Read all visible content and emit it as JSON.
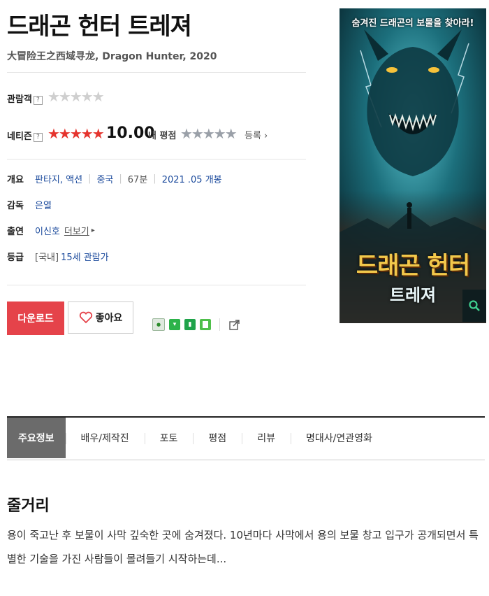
{
  "movie": {
    "title": "드래곤 헌터 트레져",
    "subtitle": "大冒险王之西域寻龙, Dragon Hunter, 2020"
  },
  "ratings": {
    "audience_label": "관람객",
    "audience_stars": 0,
    "netizen_label": "네티즌",
    "netizen_stars": 5,
    "netizen_score": "10.00",
    "my_rating_label": "내 평점",
    "my_stars": 0,
    "register_label": "등록"
  },
  "info": {
    "overview_label": "개요",
    "genre": "판타지, 액션",
    "country": "중국",
    "runtime": "67분",
    "release": "2021 .05 개봉",
    "director_label": "감독",
    "director": "은열",
    "cast_label": "출연",
    "cast": "이신호",
    "more_label": "더보기",
    "grade_label": "등급",
    "grade_region": "[국내]",
    "grade": "15세 관람가"
  },
  "actions": {
    "download_label": "다운로드",
    "like_label": "좋아요"
  },
  "poster": {
    "tagline": "숨겨진 드래곤의 보물을 찾아라!",
    "title_line1": "드래곤 헌터",
    "title_line2": "트레져"
  },
  "tabs": [
    {
      "label": "주요정보",
      "active": true
    },
    {
      "label": "배우/제작진",
      "active": false
    },
    {
      "label": "포토",
      "active": false
    },
    {
      "label": "평점",
      "active": false
    },
    {
      "label": "리뷰",
      "active": false
    },
    {
      "label": "명대사/연관영화",
      "active": false
    }
  ],
  "plot": {
    "heading": "줄거리",
    "text": "용이 죽고난 후 보물이 사막 깊숙한 곳에 숨겨졌다. 10년마다 사막에서 용의 보물 창고 입구가 공개되면서 특별한 기술을 가진 사람들이 몰려들기 시작하는데..."
  },
  "colors": {
    "accent_red": "#e5434a",
    "star_red": "#e5342e",
    "link_blue": "#1b4a9c"
  }
}
